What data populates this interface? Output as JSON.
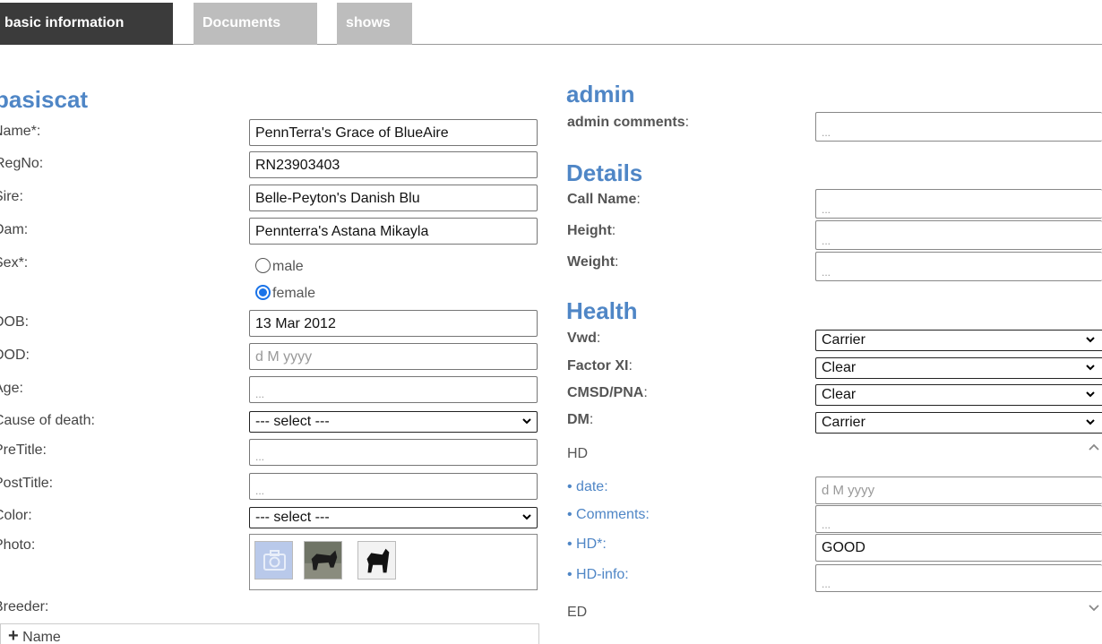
{
  "tabs": [
    {
      "label": "basic information",
      "active": true
    },
    {
      "label": "Documents",
      "active": false
    },
    {
      "label": "shows",
      "active": false
    }
  ],
  "left": {
    "title": "basiscat",
    "fields": {
      "name": {
        "label": "Name*:",
        "value": "PennTerra's Grace of BlueAire"
      },
      "regno": {
        "label": "RegNo:",
        "value": "RN23903403"
      },
      "sire": {
        "label": "Sire:",
        "value": "Belle-Peyton's Danish Blu"
      },
      "dam": {
        "label": "Dam:",
        "value": "Pennterra's Astana Mikayla"
      },
      "sex": {
        "label": "Sex*:",
        "options": [
          "male",
          "female"
        ],
        "selected": "female"
      },
      "dob": {
        "label": "DOB:",
        "value": "13 Mar 2012"
      },
      "dod": {
        "label": "DOD:",
        "placeholder": "d M yyyy"
      },
      "age": {
        "label": "Age:",
        "placeholder": "..."
      },
      "cause": {
        "label": "Cause of death:",
        "value": "--- select ---"
      },
      "pretitle": {
        "label": "PreTitle:",
        "placeholder": "..."
      },
      "posttitle": {
        "label": "PostTitle:",
        "placeholder": "..."
      },
      "color": {
        "label": "Color:",
        "value": "--- select ---"
      },
      "photo": {
        "label": "Photo:"
      },
      "breeder": {
        "label": "Breeder:",
        "add_label": "Name"
      }
    }
  },
  "admin": {
    "title": "admin",
    "comments_label": "admin comments",
    "comments_placeholder": "..."
  },
  "details": {
    "title": "Details",
    "call_name": {
      "label": "Call Name",
      "placeholder": "..."
    },
    "height": {
      "label": "Height",
      "placeholder": "..."
    },
    "weight": {
      "label": "Weight",
      "placeholder": "..."
    }
  },
  "health": {
    "title": "Health",
    "vwd": {
      "label": "Vwd",
      "value": "Carrier"
    },
    "factor_xi": {
      "label": "Factor XI",
      "value": "Clear"
    },
    "cmsd": {
      "label": "CMSD/PNA",
      "value": "Clear"
    },
    "dm": {
      "label": "DM",
      "value": "Carrier"
    },
    "hd": {
      "label": "HD",
      "date": {
        "label": "• date:",
        "placeholder": "d M yyyy"
      },
      "comments": {
        "label": "• Comments:",
        "placeholder": "..."
      },
      "hd": {
        "label": "• HD*:",
        "value": "GOOD"
      },
      "info": {
        "label": "• HD-info:",
        "placeholder": "..."
      }
    },
    "ed": {
      "label": "ED"
    }
  },
  "colors": {
    "accent": "#4f86c6",
    "tab_active": "#3b3b3b",
    "tab_inactive": "#bdbdbd",
    "radio_selected": "#1a73e8"
  }
}
